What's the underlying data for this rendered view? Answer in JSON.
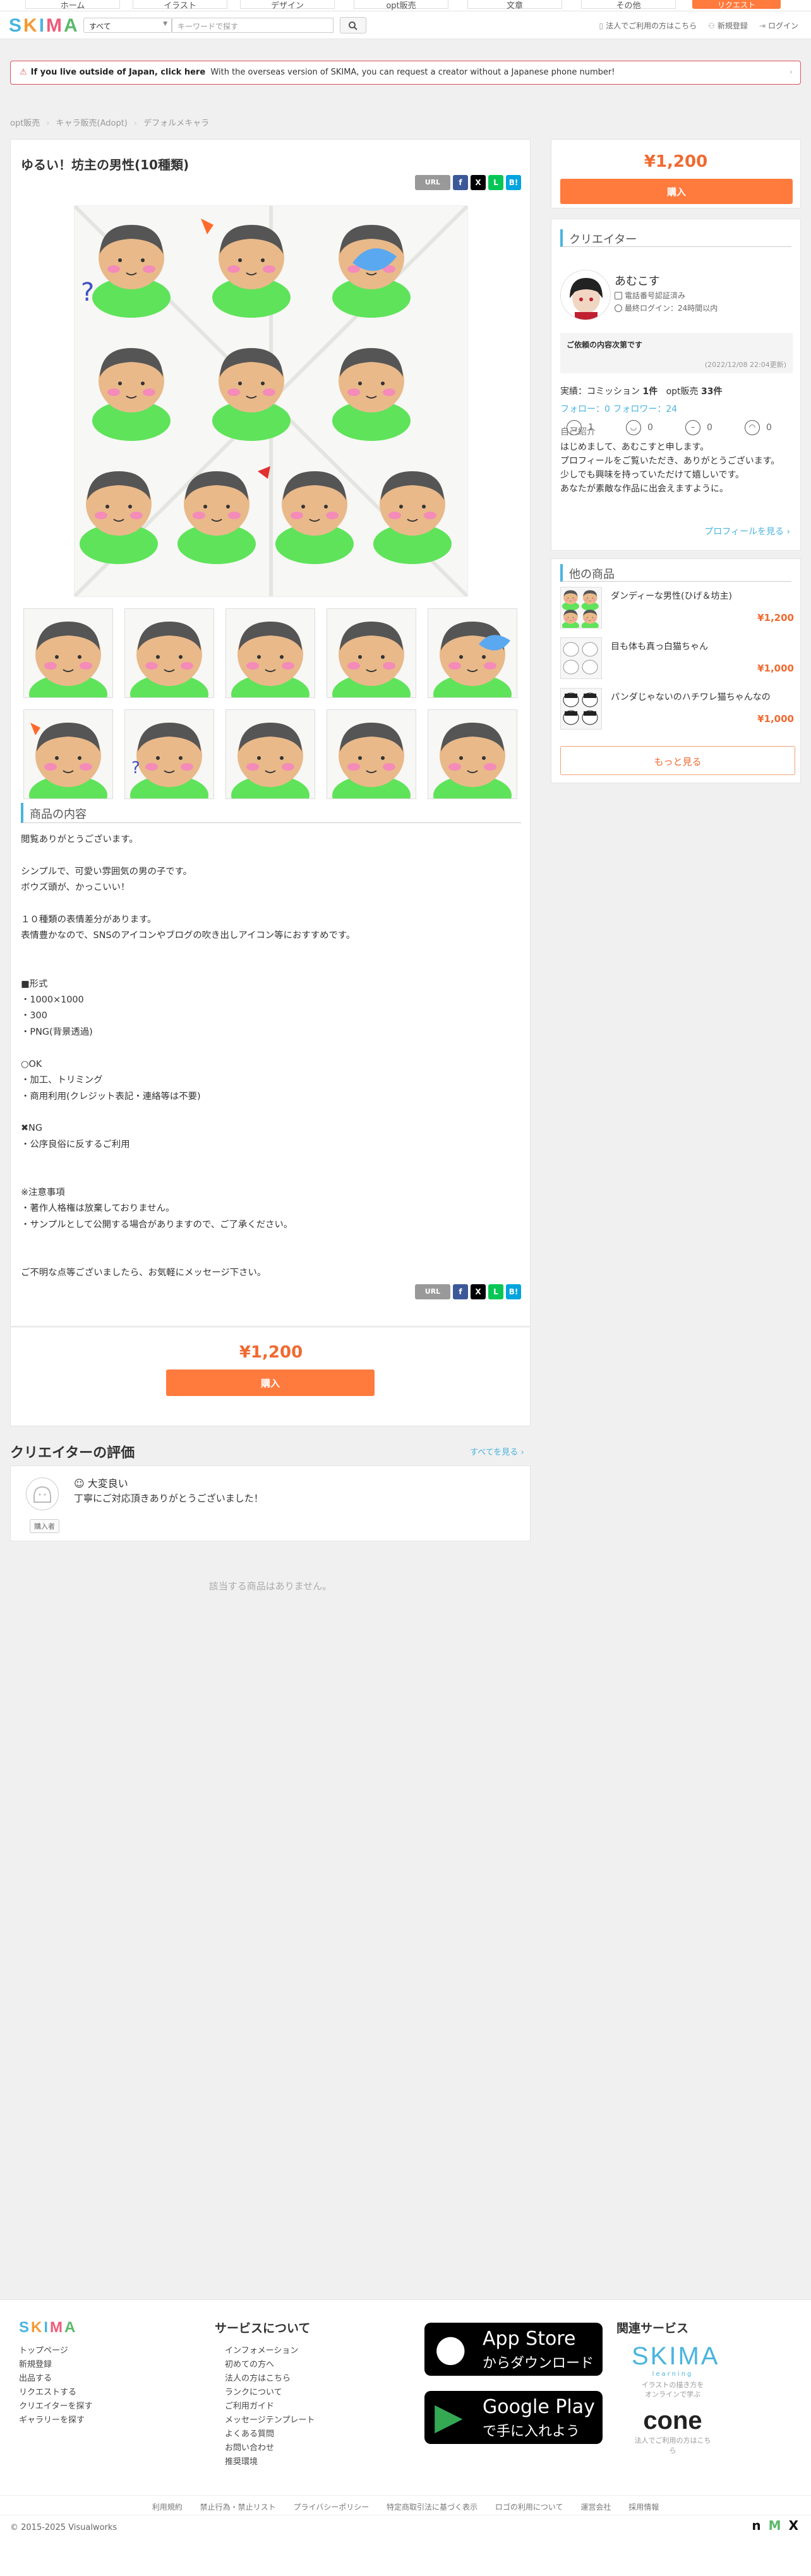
{
  "top_categories": [
    "ホーム",
    "イラスト",
    "デザイン",
    "opt販売",
    "文章",
    "その他"
  ],
  "top_request_label": "リクエスト",
  "header": {
    "logo_letters": [
      "S",
      "K",
      "I",
      "M",
      "A"
    ],
    "category_select": "すべて",
    "keyword_placeholder": "キーワードで探す",
    "search_label": "検索",
    "links": [
      {
        "icon": "phone-icon",
        "label": "法人でご利用の方はこちら"
      },
      {
        "icon": "user-plus-icon",
        "label": "新規登録"
      },
      {
        "icon": "login-icon",
        "label": "ログイン"
      }
    ]
  },
  "notice": {
    "bold": "If you live outside of Japan, click here",
    "text": "With the overseas version of SKIMA, you can request a creator without a Japanese phone number!"
  },
  "breadcrumbs": [
    "opt販売",
    "キャラ販売(Adopt)",
    "デフォルメキャラ"
  ],
  "product": {
    "title": "ゆるい！坊主の男性(10種類)",
    "share": {
      "url": "URL",
      "facebook": "f",
      "x": "X",
      "line": "L",
      "hatena": "B!"
    },
    "section_title": "商品の内容",
    "description": "閲覧ありがとうございます。\n\nシンプルで、可愛い雰囲気の男の子です。\nボウズ頭が、かっこいい！\n\n１０種類の表情差分があります。\n表情豊かなので、SNSのアイコンやブログの吹き出しアイコン等におすすめです。\n\n\n■形式\n・1000×1000\n・300\n・PNG(背景透過)\n\n○OK\n・加工、トリミング\n・商用利用(クレジット表記・連絡等は不要)\n\n✖NG\n・公序良俗に反するご利用\n\n\n※注意事項\n・著作人格権は放棄しておりません。\n・サンプルとして公開する場合がありますので、ご了承ください。\n\n\nご不明な点等ございましたら、お気軽にメッセージ下さい。",
    "price": "¥1,200",
    "buy_label": "購入"
  },
  "reviews": {
    "title": "クリエイターの評価",
    "see_all": "すべてを見る ›",
    "items": [
      {
        "rating": "大変良い",
        "text": "丁寧にご対応頂きありがとうございました！",
        "badge": "購入者"
      }
    ]
  },
  "related_empty": "該当する商品はありません。",
  "sidebar": {
    "price": "¥1,200",
    "buy_label": "購入",
    "creator_heading": "クリエイター",
    "creator": {
      "name": "あむこす",
      "badge_phone": "電話番号認証済み",
      "badge_login": "最終ログイン：24時間以内",
      "request_status": "ご依頼の内容次第です",
      "request_date": "(2022/12/08 22:04更新)",
      "commission_label": "実績：コミッション",
      "commission_count": "1件",
      "opt_label": "opt販売",
      "opt_count": "33件",
      "follow_label": "フォロー：",
      "follow_count": "0",
      "follower_label": "フォロワー：",
      "follower_count": "24",
      "ratings": [
        "1",
        "0",
        "0",
        "0"
      ],
      "intro_heading": "自己紹介",
      "intro": "はじめまして、あむこすと申します。\nプロフィールをご覧いただき、ありがとうございます。\n少しでも興味を持っていただけて嬉しいです。\nあなたが素敵な作品に出会えますように。",
      "profile_link": "プロフィールを見る ›"
    },
    "other_heading": "他の商品",
    "other_products": [
      {
        "name": "ダンディーな男性(ひげ＆坊主)",
        "price": "¥1,200"
      },
      {
        "name": "目も体も真っ白猫ちゃん",
        "price": "¥1,000"
      },
      {
        "name": "パンダじゃないのハチワレ猫ちゃんなの",
        "price": "¥1,000"
      }
    ],
    "more_label": "もっと見る"
  },
  "footer": {
    "col1": [
      "トップページ",
      "新規登録",
      "出品する",
      "リクエストする",
      "クリエイターを探す",
      "ギャラリーを探す"
    ],
    "about_heading": "サービスについて",
    "col2": [
      "インフォメーション",
      "初めての方へ",
      "法人の方はこちら",
      "ランクについて",
      "ご利用ガイド",
      "メッセージテンプレート",
      "よくある質問",
      "お問い合わせ",
      "推奨環境"
    ],
    "appstore": {
      "line1": "App Store",
      "line2": "からダウンロード"
    },
    "googleplay": {
      "line1": "Google Play",
      "line2": "で手に入れよう"
    },
    "related_heading": "関連サービス",
    "skima_learning": {
      "logo": "SKIMA",
      "sub": "learning",
      "desc": "イラストの描き方を\nオンラインで学ぶ"
    },
    "cone": {
      "logo": "cone",
      "desc": "法人でご利用の方はこちら"
    },
    "bottom_links": [
      "利用規約",
      "禁止行為・禁止リスト",
      "プライバシーポリシー",
      "特定商取引法に基づく表示",
      "ロゴの利用について",
      "運営会社",
      "採用情報"
    ],
    "copyright": "© 2015-2025 Visualworks"
  }
}
